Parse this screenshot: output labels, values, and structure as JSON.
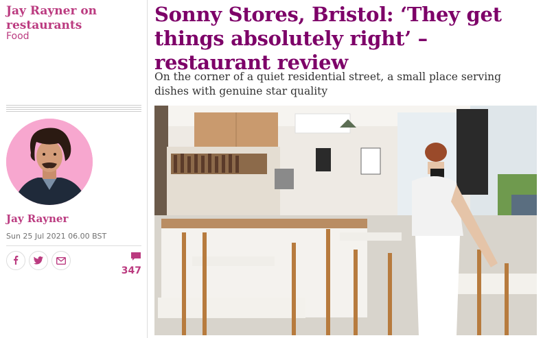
{
  "article": {
    "series": "Jay Rayner on restaurants",
    "section": "Food",
    "headline": "Sonny Stores, Bristol: ‘They get things absolutely right’ – restaurant review",
    "standfirst": "On the corner of a quiet residential street, a small place serving dishes with genuine star quality",
    "author": "Jay Rayner",
    "dateline": "Sun 25 Jul 2021 06.00 BST",
    "comment_count": "347"
  },
  "share": {
    "icons": [
      "facebook-icon",
      "twitter-icon",
      "email-icon"
    ]
  },
  "colors": {
    "accent": "#bb3b80",
    "headline": "#7d0068",
    "avatar_bg": "#f7a7cf"
  }
}
